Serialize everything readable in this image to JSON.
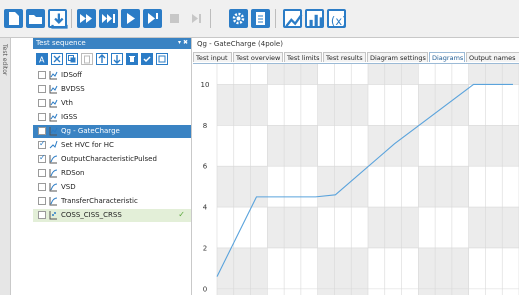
{
  "sidebar_tab_label": "Test editor",
  "panel": {
    "title": "Test sequence",
    "pin": "▾ ✖"
  },
  "tree": [
    {
      "label": "IDSoff",
      "checked": false,
      "state": "normal",
      "icon": "chart-icon"
    },
    {
      "label": "BVDSS",
      "checked": false,
      "state": "normal",
      "icon": "chart-icon"
    },
    {
      "label": "Vth",
      "checked": false,
      "state": "normal",
      "icon": "chart-icon"
    },
    {
      "label": "IGSS",
      "checked": false,
      "state": "normal",
      "icon": "chart-icon"
    },
    {
      "label": "Qg - GateCharge",
      "checked": false,
      "state": "selected",
      "icon": "chart-icon"
    },
    {
      "label": "Set HVC for HC",
      "checked": true,
      "state": "normal",
      "icon": "settings-icon"
    },
    {
      "label": "OutputCharacteristicPulsed",
      "checked": true,
      "state": "normal",
      "icon": "curve-icon"
    },
    {
      "label": "RDSon",
      "checked": false,
      "state": "normal",
      "icon": "curve-icon"
    },
    {
      "label": "VSD",
      "checked": false,
      "state": "normal",
      "icon": "curve-icon"
    },
    {
      "label": "TransferCharacteristic",
      "checked": false,
      "state": "normal",
      "icon": "curve-icon"
    },
    {
      "label": "COSS_CISS_CRSS",
      "checked": false,
      "state": "done",
      "icon": "dots-icon"
    }
  ],
  "graph_title": "Qg - GateCharge (4pole)",
  "tabs": [
    {
      "label": "Test input",
      "active": false
    },
    {
      "label": "Test overview",
      "active": false
    },
    {
      "label": "Test limits",
      "active": false
    },
    {
      "label": "Test results",
      "active": false
    },
    {
      "label": "Diagram settings",
      "active": false
    },
    {
      "label": "Diagrams",
      "active": true
    },
    {
      "label": "Output names",
      "active": false
    }
  ],
  "colors": {
    "accent": "#2b7cc6",
    "selected": "#3a83c3",
    "curve": "#5aa3dc",
    "done": "#e3efd8"
  },
  "chart_data": {
    "type": "line",
    "title": "",
    "xlabel": "",
    "ylabel": "",
    "ylim": [
      -0.3,
      11
    ],
    "yticks": [
      0,
      2,
      4,
      6,
      8,
      10
    ],
    "x": [
      0,
      2,
      4,
      5,
      6,
      9,
      13,
      15
    ],
    "series": [
      {
        "values": [
          0.6,
          4.5,
          4.5,
          4.5,
          4.6,
          7.1,
          10.0,
          10.0
        ]
      }
    ],
    "grid": true
  }
}
